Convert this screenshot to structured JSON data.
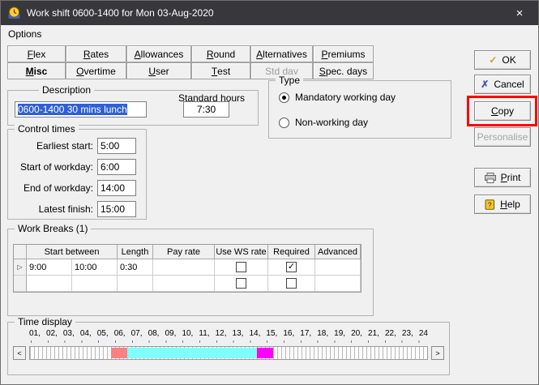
{
  "window": {
    "title": "Work shift 0600-1400 for Mon 03-Aug-2020",
    "close_glyph": "×",
    "titlebar_color": "#38383c"
  },
  "menubar": {
    "options_label": "Options"
  },
  "tabs": {
    "row1": [
      {
        "label": "Flex",
        "accel": 0
      },
      {
        "label": "Rates",
        "accel": 0
      },
      {
        "label": "Allowances",
        "accel": 0
      },
      {
        "label": "Round",
        "accel": 0
      },
      {
        "label": "Alternatives",
        "accel": 0
      },
      {
        "label": "Premiums",
        "accel": 0
      }
    ],
    "row2": [
      {
        "label": "Misc",
        "accel": 0,
        "selected": true
      },
      {
        "label": "Overtime",
        "accel": 0
      },
      {
        "label": "User",
        "accel": 0
      },
      {
        "label": "Test",
        "accel": 0
      },
      {
        "label": "Std day",
        "accel": -1,
        "disabled": true
      },
      {
        "label": "Spec. days",
        "accel": 0
      }
    ]
  },
  "action_buttons": {
    "ok": {
      "label": "OK",
      "accel": -1,
      "icon_glyph": "✓"
    },
    "cancel": {
      "label": "Cancel",
      "accel": -1,
      "icon_glyph": "✗"
    },
    "copy": {
      "label": "Copy",
      "accel": 0
    },
    "personalise": {
      "label": "Personalise",
      "accel": -1,
      "disabled": true
    },
    "print": {
      "label": "Print",
      "accel": 0
    },
    "help": {
      "label": "Help",
      "accel": 0
    }
  },
  "annotation": {
    "color": "#ff0000"
  },
  "description_group": {
    "legend": "Description",
    "value": "0600-1400 30 mins lunch",
    "selection_color": "#2e5fd7",
    "standard_hours_label": "Standard hours",
    "standard_hours_value": "7:30"
  },
  "type_group": {
    "legend": "Type",
    "options": [
      {
        "label": "Mandatory working day",
        "selected": true
      },
      {
        "label": "Non-working day",
        "selected": false
      }
    ]
  },
  "control_times": {
    "legend": "Control times",
    "rows": [
      {
        "label": "Earliest start:",
        "value": "5:00"
      },
      {
        "label": "Start of workday:",
        "value": "6:00"
      },
      {
        "label": "End of workday:",
        "value": "14:00"
      },
      {
        "label": "Latest finish:",
        "value": "15:00"
      }
    ]
  },
  "work_breaks": {
    "legend": "Work Breaks (1)",
    "headers": {
      "start_between": "Start between",
      "length": "Length",
      "pay_rate": "Pay rate",
      "use_ws_rate": "Use WS rate",
      "required": "Required",
      "advanced": "Advanced"
    },
    "row_marker": "▷",
    "rows": [
      {
        "start_from": "9:00",
        "start_to": "10:00",
        "length": "0:30",
        "pay_rate": "",
        "use_ws_rate": false,
        "required": true,
        "advanced": ""
      },
      {
        "start_from": "",
        "start_to": "",
        "length": "",
        "pay_rate": "",
        "use_ws_rate": false,
        "required": false,
        "advanced": ""
      }
    ]
  },
  "time_display": {
    "legend": "Time display",
    "hours": [
      "01",
      "02",
      "03",
      "04",
      "05",
      "06",
      "07",
      "08",
      "09",
      "10",
      "11",
      "12",
      "13",
      "14",
      "15",
      "16",
      "17",
      "18",
      "19",
      "20",
      "21",
      "22",
      "23",
      "24"
    ],
    "segments": [
      {
        "name": "early-window",
        "from": 5,
        "to": 6,
        "color": "#ff8080"
      },
      {
        "name": "workday",
        "from": 6,
        "to": 14,
        "color": "#80ffff"
      },
      {
        "name": "late-window",
        "from": 14,
        "to": 15,
        "color": "#ff00ff"
      }
    ],
    "left_arrow": "<",
    "right_arrow": ">"
  }
}
